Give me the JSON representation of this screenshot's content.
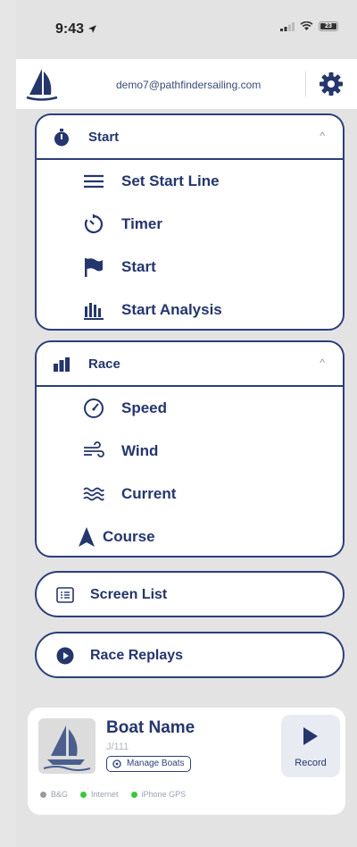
{
  "status_bar": {
    "time": "9:43",
    "battery": "23"
  },
  "header": {
    "email": "demo7@pathfindersailing.com"
  },
  "start_section": {
    "title": "Start",
    "items": [
      {
        "label": "Set Start Line",
        "icon": "lines-icon"
      },
      {
        "label": "Timer",
        "icon": "timer-icon"
      },
      {
        "label": "Start",
        "icon": "flag-icon"
      },
      {
        "label": "Start Analysis",
        "icon": "bar-chart-icon"
      }
    ]
  },
  "race_section": {
    "title": "Race",
    "items": [
      {
        "label": "Speed",
        "icon": "speedometer-icon"
      },
      {
        "label": "Wind",
        "icon": "wind-icon"
      },
      {
        "label": "Current",
        "icon": "waves-icon"
      },
      {
        "label": "Course",
        "icon": "arrow-icon"
      }
    ]
  },
  "screen_list": {
    "label": "Screen List"
  },
  "race_replays": {
    "label": "Race Replays"
  },
  "boat": {
    "name": "Boat Name",
    "model": "J/111",
    "manage_label": "Manage Boats",
    "record_label": "Record",
    "statuses": [
      {
        "label": "B&G",
        "color": "#9a9a9a"
      },
      {
        "label": "Internet",
        "color": "#3cc83c"
      },
      {
        "label": "iPhone GPS",
        "color": "#3cc83c"
      }
    ]
  },
  "colors": {
    "accent": "#24366c",
    "border": "#2c3f7a"
  }
}
